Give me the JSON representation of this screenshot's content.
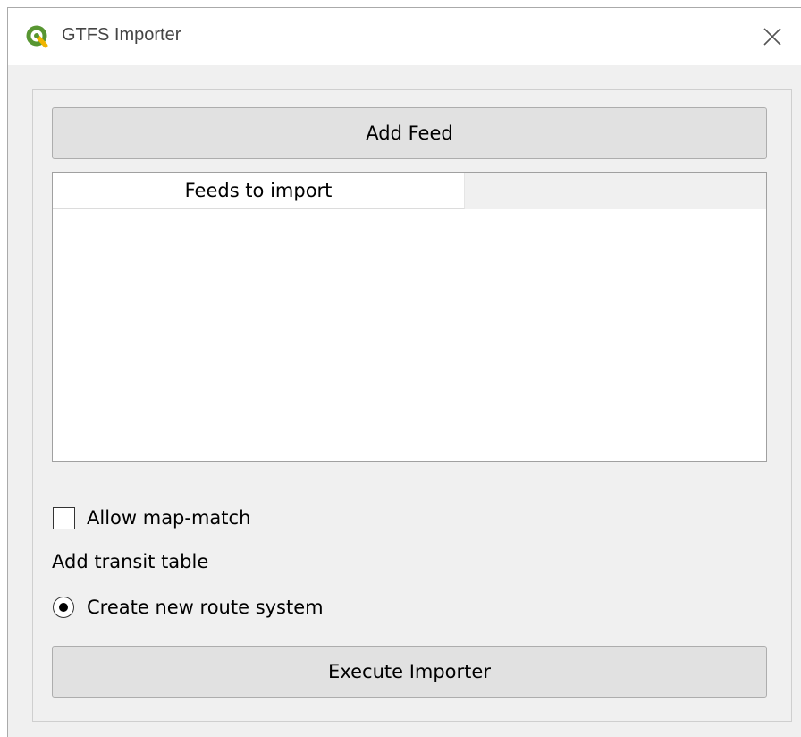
{
  "window": {
    "title": "GTFS Importer",
    "icon": "qgis-logo-icon",
    "close_icon": "close-icon"
  },
  "buttons": {
    "add_feed": "Add Feed",
    "execute": "Execute Importer"
  },
  "feeds_table": {
    "columns": [
      "Feeds to import"
    ],
    "rows": []
  },
  "options": {
    "allow_map_match": {
      "label": "Allow map-match",
      "checked": false
    },
    "transit_table_label": "Add transit table",
    "route_system": {
      "label": "Create new route system",
      "selected": true
    }
  },
  "colors": {
    "qgis_green": "#589632",
    "qgis_yellow": "#ee7913"
  }
}
